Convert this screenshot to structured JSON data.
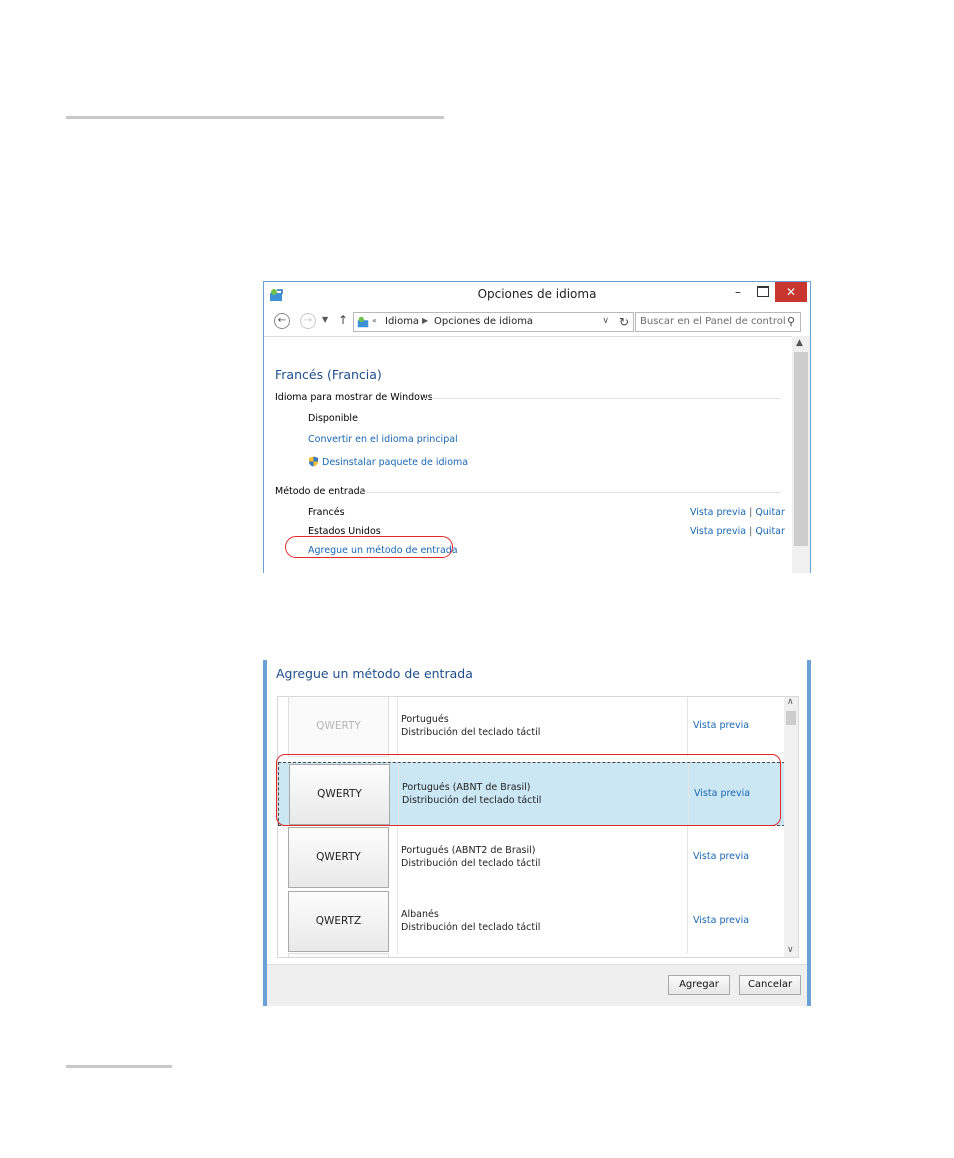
{
  "window1": {
    "title": "Opciones de idioma",
    "controls": {
      "minimize": "–",
      "close": "✕"
    },
    "address": {
      "overflow": "«",
      "crumbs": [
        "Idioma",
        "Opciones de idioma"
      ],
      "search_placeholder": "Buscar en el Panel de control"
    },
    "language_title": "Francés (Francia)",
    "display_section": {
      "heading": "Idioma para mostrar de Windows",
      "status": "Disponible",
      "make_primary_link": "Convertir en el idioma principal",
      "uninstall_link": "Desinstalar paquete de idioma"
    },
    "input_section": {
      "heading": "Método de entrada",
      "methods": [
        {
          "name": "Francés",
          "preview": "Vista previa",
          "remove": "Quitar"
        },
        {
          "name": "Estados Unidos",
          "preview": "Vista previa",
          "remove": "Quitar"
        }
      ],
      "add_link": "Agregue un método de entrada"
    }
  },
  "window2": {
    "title": "Agregue un método de entrada",
    "rows": [
      {
        "layout": "QWERTY",
        "language": "Portugués",
        "type": "Distribución del teclado táctil",
        "preview": "Vista previa",
        "selected": false
      },
      {
        "layout": "QWERTY",
        "language": "Portugués (ABNT de Brasil)",
        "type": "Distribución del teclado táctil",
        "preview": "Vista previa",
        "selected": true
      },
      {
        "layout": "QWERTY",
        "language": "Portugués (ABNT2 de Brasil)",
        "type": "Distribución del teclado táctil",
        "preview": "Vista previa",
        "selected": false
      },
      {
        "layout": "QWERTZ",
        "language": "Albanés",
        "type": "Distribución del teclado táctil",
        "preview": "Vista previa",
        "selected": false
      }
    ],
    "buttons": {
      "add": "Agregar",
      "cancel": "Cancelar"
    }
  },
  "colors": {
    "link": "#1a66b3",
    "heading": "#1e4e8c",
    "selection": "#cbe7f4",
    "annotation": "#e02a2a",
    "close": "#c7372f"
  }
}
